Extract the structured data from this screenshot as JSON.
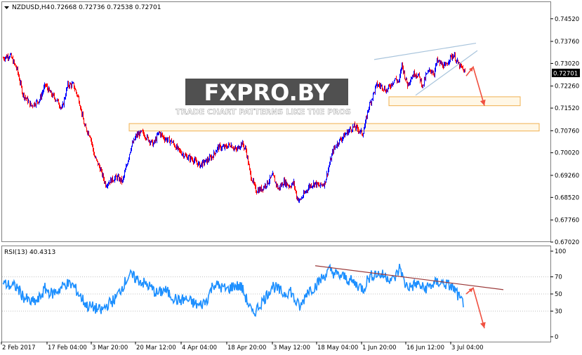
{
  "header": {
    "symbol": "NZDUSD,H4",
    "ohlc": "0.72668 0.72736 0.72538 0.72701"
  },
  "watermark": {
    "brand": "FXPRO.BY",
    "tagline": "TRADE CHART PATTERNS LIKE THE PROS"
  },
  "rsi_panel": {
    "label": "RSI(13) 40.4313"
  },
  "colors": {
    "bull": "#0000ff",
    "bear": "#ff0000",
    "rsi": "#1e90ff",
    "trendline": "#9b3a3a",
    "wedge": "#a8c4dc",
    "zone_border": "#f0b050",
    "zone_fill": "#fff7e6",
    "arrow": "#f05040",
    "last_price_bg": "#000000"
  },
  "chart_data": [
    {
      "type": "candlestick",
      "symbol": "NZDUSD",
      "timeframe": "H4",
      "last_price": "0.72701",
      "ylim": [
        0.6702,
        0.7475
      ],
      "y_ticks": [
        "0.74520",
        "0.73760",
        "0.73020",
        "0.72260",
        "0.71520",
        "0.70760",
        "0.70020",
        "0.69260",
        "0.68520",
        "0.67760",
        "0.67020"
      ],
      "x_ticks": [
        "2 Feb 2017",
        "17 Feb 04:00",
        "3 Mar 20:00",
        "20 Mar 12:00",
        "4 Apr 04:00",
        "18 Apr 20:00",
        "3 May 12:00",
        "18 May 04:00",
        "1 Jun 20:00",
        "16 Jun 12:00",
        "3 Jul 04:00"
      ],
      "price_path": [
        [
          0,
          0.732
        ],
        [
          10,
          0.733
        ],
        [
          20,
          0.728
        ],
        [
          28,
          0.72
        ],
        [
          40,
          0.716
        ],
        [
          52,
          0.718
        ],
        [
          60,
          0.723
        ],
        [
          68,
          0.72
        ],
        [
          76,
          0.718
        ],
        [
          84,
          0.715
        ],
        [
          92,
          0.723
        ],
        [
          100,
          0.723
        ],
        [
          108,
          0.718
        ],
        [
          116,
          0.709
        ],
        [
          124,
          0.706
        ],
        [
          130,
          0.699
        ],
        [
          138,
          0.695
        ],
        [
          146,
          0.6895
        ],
        [
          154,
          0.691
        ],
        [
          162,
          0.692
        ],
        [
          170,
          0.6905
        ],
        [
          176,
          0.696
        ],
        [
          182,
          0.702
        ],
        [
          190,
          0.706
        ],
        [
          198,
          0.707
        ],
        [
          206,
          0.705
        ],
        [
          214,
          0.703
        ],
        [
          222,
          0.707
        ],
        [
          230,
          0.705
        ],
        [
          240,
          0.704
        ],
        [
          250,
          0.701
        ],
        [
          260,
          0.699
        ],
        [
          270,
          0.698
        ],
        [
          280,
          0.696
        ],
        [
          290,
          0.6975
        ],
        [
          298,
          0.699
        ],
        [
          306,
          0.702
        ],
        [
          316,
          0.702
        ],
        [
          324,
          0.703
        ],
        [
          332,
          0.701
        ],
        [
          340,
          0.7035
        ],
        [
          346,
          0.701
        ],
        [
          352,
          0.693
        ],
        [
          360,
          0.6875
        ],
        [
          368,
          0.688
        ],
        [
          376,
          0.69
        ],
        [
          384,
          0.6925
        ],
        [
          392,
          0.688
        ],
        [
          400,
          0.6905
        ],
        [
          408,
          0.689
        ],
        [
          414,
          0.69
        ],
        [
          418,
          0.6855
        ],
        [
          422,
          0.684
        ],
        [
          428,
          0.686
        ],
        [
          436,
          0.689
        ],
        [
          444,
          0.69
        ],
        [
          450,
          0.689
        ],
        [
          458,
          0.69
        ],
        [
          464,
          0.6955
        ],
        [
          470,
          0.701
        ],
        [
          478,
          0.704
        ],
        [
          486,
          0.706
        ],
        [
          494,
          0.708
        ],
        [
          500,
          0.709
        ],
        [
          506,
          0.708
        ],
        [
          512,
          0.7065
        ],
        [
          516,
          0.71
        ],
        [
          520,
          0.715
        ],
        [
          526,
          0.719
        ],
        [
          532,
          0.723
        ],
        [
          540,
          0.7225
        ],
        [
          546,
          0.721
        ],
        [
          552,
          0.723
        ],
        [
          558,
          0.725
        ],
        [
          564,
          0.724
        ],
        [
          568,
          0.73
        ],
        [
          572,
          0.726
        ],
        [
          576,
          0.723
        ],
        [
          580,
          0.725
        ],
        [
          586,
          0.727
        ],
        [
          592,
          0.726
        ],
        [
          598,
          0.7225
        ],
        [
          602,
          0.726
        ],
        [
          608,
          0.728
        ],
        [
          614,
          0.727
        ],
        [
          618,
          0.731
        ],
        [
          624,
          0.73
        ],
        [
          630,
          0.729
        ],
        [
          636,
          0.732
        ],
        [
          642,
          0.733
        ],
        [
          648,
          0.73
        ],
        [
          654,
          0.7285
        ],
        [
          658,
          0.727
        ]
      ],
      "annotations": {
        "wedge_upper": [
          [
            533,
            0.7315
          ],
          [
            678,
            0.737
          ]
        ],
        "wedge_lower": [
          [
            592,
            0.7195
          ],
          [
            680,
            0.7345
          ]
        ],
        "resistance_zone_1": {
          "x": [
            554,
            741
          ],
          "y": [
            0.716,
            0.719
          ]
        },
        "resistance_zone_2": {
          "x": [
            184,
            768
          ],
          "y": [
            0.7075,
            0.71
          ]
        },
        "projection_arrow": [
          [
            664,
            0.726
          ],
          [
            674,
            0.729
          ],
          [
            690,
            0.716
          ]
        ]
      }
    },
    {
      "type": "line",
      "name": "RSI(13)",
      "last_value": 40.4313,
      "ylim": [
        0,
        100
      ],
      "y_ticks": [
        "100",
        "70",
        "50",
        "30",
        "0"
      ],
      "levels": [
        70,
        50,
        30
      ],
      "rsi_path": [
        [
          0,
          62
        ],
        [
          20,
          58
        ],
        [
          30,
          46
        ],
        [
          40,
          40
        ],
        [
          50,
          42
        ],
        [
          60,
          56
        ],
        [
          70,
          50
        ],
        [
          80,
          55
        ],
        [
          90,
          62
        ],
        [
          100,
          60
        ],
        [
          110,
          48
        ],
        [
          120,
          36
        ],
        [
          130,
          34
        ],
        [
          140,
          30
        ],
        [
          150,
          38
        ],
        [
          160,
          44
        ],
        [
          170,
          58
        ],
        [
          180,
          72
        ],
        [
          190,
          68
        ],
        [
          200,
          63
        ],
        [
          210,
          58
        ],
        [
          220,
          50
        ],
        [
          230,
          55
        ],
        [
          240,
          48
        ],
        [
          250,
          42
        ],
        [
          260,
          44
        ],
        [
          270,
          40
        ],
        [
          280,
          36
        ],
        [
          290,
          42
        ],
        [
          300,
          62
        ],
        [
          310,
          58
        ],
        [
          320,
          55
        ],
        [
          330,
          60
        ],
        [
          340,
          58
        ],
        [
          350,
          38
        ],
        [
          356,
          26
        ],
        [
          364,
          35
        ],
        [
          374,
          46
        ],
        [
          384,
          60
        ],
        [
          392,
          55
        ],
        [
          400,
          50
        ],
        [
          410,
          54
        ],
        [
          416,
          42
        ],
        [
          424,
          34
        ],
        [
          434,
          54
        ],
        [
          444,
          58
        ],
        [
          454,
          68
        ],
        [
          466,
          78
        ],
        [
          476,
          72
        ],
        [
          486,
          70
        ],
        [
          496,
          65
        ],
        [
          506,
          60
        ],
        [
          514,
          56
        ],
        [
          520,
          68
        ],
        [
          530,
          74
        ],
        [
          540,
          72
        ],
        [
          548,
          70
        ],
        [
          556,
          66
        ],
        [
          562,
          74
        ],
        [
          566,
          82
        ],
        [
          572,
          62
        ],
        [
          580,
          58
        ],
        [
          590,
          62
        ],
        [
          600,
          56
        ],
        [
          610,
          60
        ],
        [
          620,
          64
        ],
        [
          630,
          62
        ],
        [
          640,
          58
        ],
        [
          646,
          52
        ],
        [
          652,
          42
        ],
        [
          656,
          40
        ]
      ],
      "annotations": {
        "trendline": [
          [
            449,
            83
          ],
          [
            717,
            55
          ]
        ],
        "projection_arrow": [
          [
            664,
            50
          ],
          [
            674,
            57
          ],
          [
            690,
            10
          ]
        ]
      }
    }
  ]
}
